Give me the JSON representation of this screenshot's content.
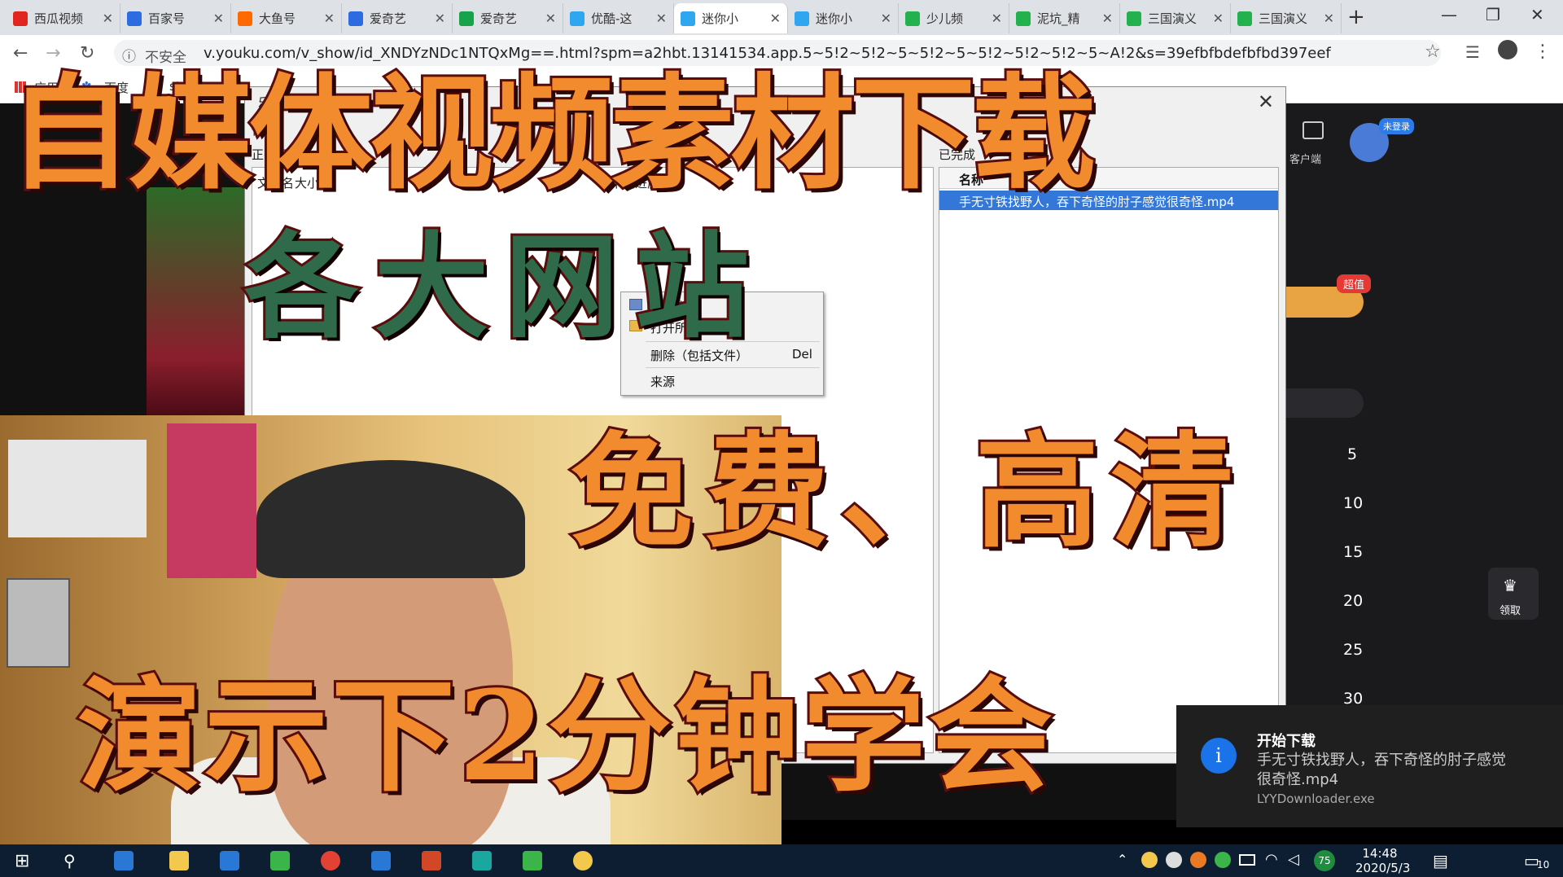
{
  "browser": {
    "tabs": [
      {
        "label": "西瓜视频",
        "color": "#e0261e"
      },
      {
        "label": "百家号",
        "color": "#2d6be0"
      },
      {
        "label": "大鱼号",
        "color": "#ff6a00"
      },
      {
        "label": "爱奇艺",
        "color": "#2d6be0"
      },
      {
        "label": "爱奇艺",
        "color": "#16a34a"
      },
      {
        "label": "优酷-这",
        "color": "#2ea7f0"
      },
      {
        "label": "迷你小",
        "color": "#2ea7f0"
      },
      {
        "label": "迷你小",
        "color": "#2ea7f0"
      },
      {
        "label": "少儿频",
        "color": "#22b14c"
      },
      {
        "label": "泥坑_精",
        "color": "#22b14c"
      },
      {
        "label": "三国演义",
        "color": "#22b14c"
      },
      {
        "label": "三国演义",
        "color": "#22b14c"
      }
    ],
    "insecure": "不安全",
    "url": "v.youku.com/v_show/id_XNDYzNDc1NTQxMg==.html?spm=a2hbt.13141534.app.5~5!2~5!2~5~5!2~5~5!2~5!2~5!2~5~A!2&s=39efbfbdefbfbd397eef",
    "bookmarks": [
      "应用",
      "百度",
      "stu"
    ]
  },
  "downloader": {
    "title": "乐影下载器",
    "menu": "使用",
    "downloading_label": "正在下载",
    "col_name": "文件名",
    "col_size": "大小",
    "col_progress": "下载进度",
    "context_menu": [
      "打开文件",
      "打开所在文件夹",
      "删除（包括文件）",
      "来源"
    ],
    "context_shortcut": "Del",
    "done_label": "已完成",
    "done_col": "名称",
    "done_file": "手无寸铁找野人，吞下奇怪的肘子感觉很奇怪.mp4"
  },
  "notification": {
    "title": "开始下载",
    "body": "手无寸铁找野人，吞下奇怪的肘子感觉很奇怪.mp4",
    "source": "LYYDownloader.exe"
  },
  "page": {
    "login": "未登录",
    "client": "客户端",
    "badge": "超值",
    "claim": "领取",
    "episodes": [
      "5",
      "10",
      "15",
      "20",
      "25",
      "30"
    ]
  },
  "overlay": {
    "line1": "自媒体视频素材下载",
    "line2": "各大网站",
    "line3": "免费、高清",
    "line4": "演示下2分钟学会"
  },
  "taskbar": {
    "time": "14:48",
    "date": "2020/5/3",
    "battery": "75",
    "notif": "10"
  }
}
